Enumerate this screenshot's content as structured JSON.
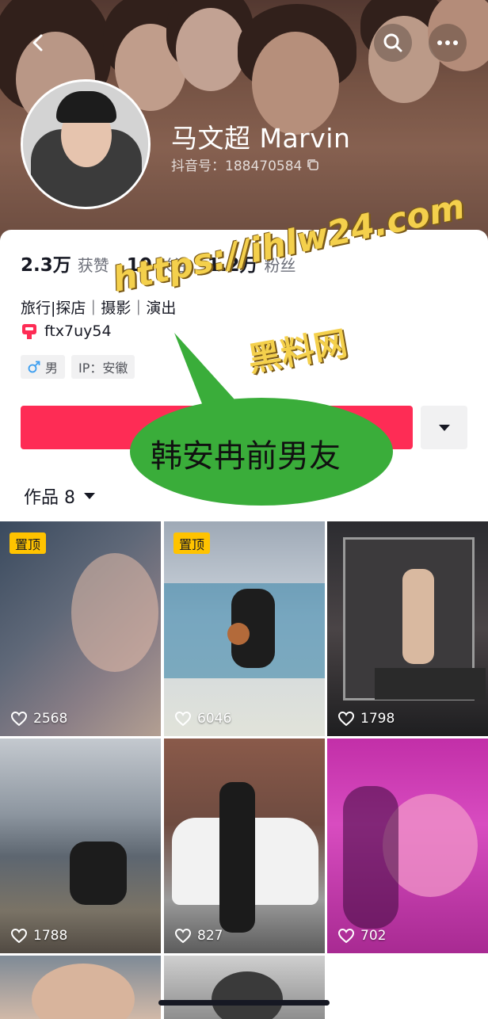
{
  "profile": {
    "name": "马文超 Marvin",
    "douyin_id": "抖音号：188470584"
  },
  "stats": [
    {
      "value": "2.3万",
      "label": "获赞"
    },
    {
      "value": "10",
      "label": "关注"
    },
    {
      "value": "1.2万",
      "label": "粉丝"
    }
  ],
  "bio": {
    "text": "旅行|探店｜摄影｜演出",
    "link_text": "ftx7uy54"
  },
  "tags": {
    "gender": "男",
    "ip": "IP：安徽"
  },
  "actions": {
    "follow_label": ""
  },
  "tabs": {
    "works_label": "作品 8"
  },
  "overlay": {
    "watermark_url": "https://ihlw24.com",
    "watermark_site": "黑料网",
    "bubble_text": "韩安冉前男友"
  },
  "videos": [
    {
      "pinned": "置顶",
      "likes": "2568"
    },
    {
      "pinned": "置顶",
      "likes": "6046"
    },
    {
      "pinned": "",
      "likes": "1798"
    },
    {
      "pinned": "",
      "likes": "1788"
    },
    {
      "pinned": "",
      "likes": "827"
    },
    {
      "pinned": "",
      "likes": "702"
    }
  ],
  "colors": {
    "accent": "#fe2c55",
    "pin_badge": "#ffc300",
    "bubble": "#3aad3a",
    "watermark": "#f4d04c"
  },
  "icons": [
    "back-icon",
    "search-icon",
    "more-icon",
    "copy-icon",
    "link-icon",
    "male-icon",
    "caret-down-icon",
    "heart-icon"
  ]
}
